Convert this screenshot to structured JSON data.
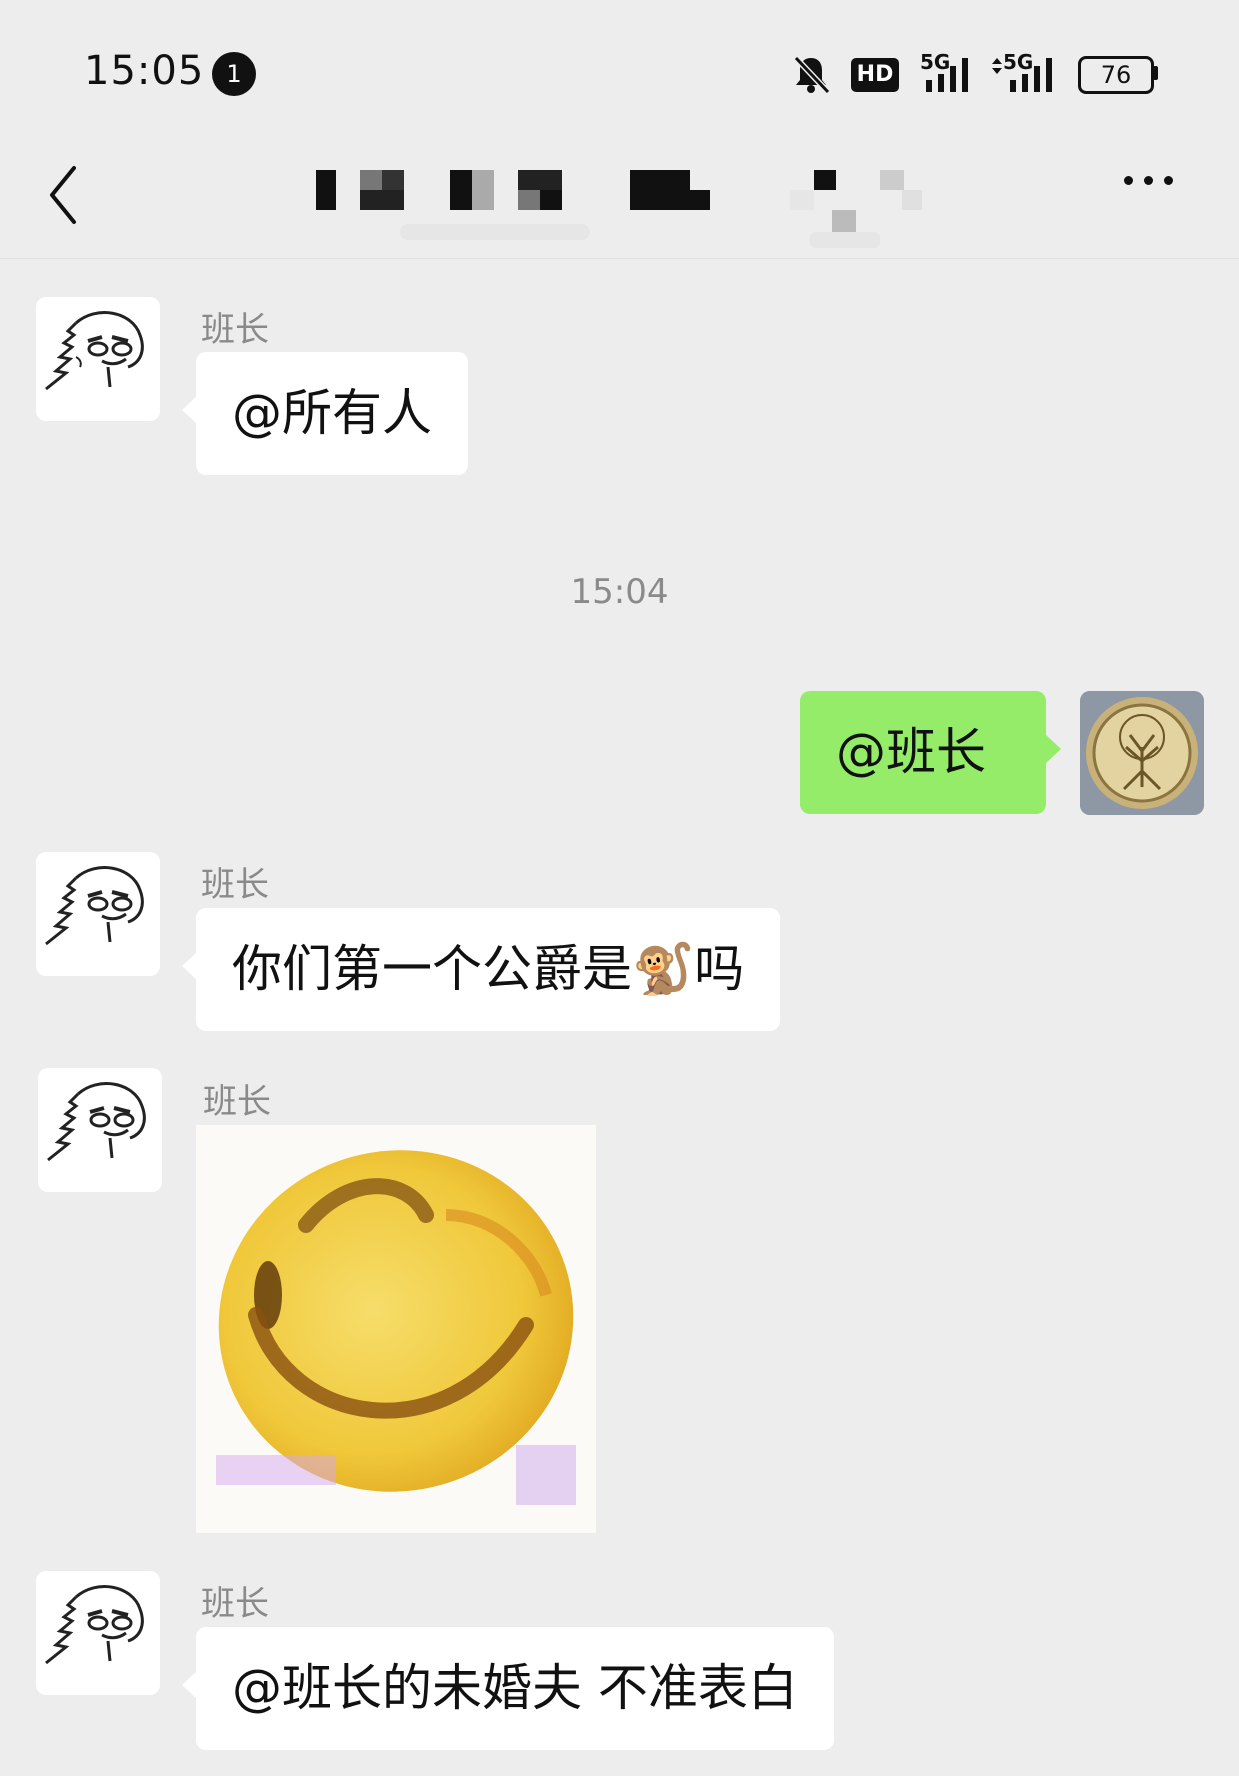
{
  "status_bar": {
    "time": "15:05",
    "notification_count": "1",
    "hd_label": "HD",
    "network_1": "5G",
    "network_2": "5G",
    "battery": "76"
  },
  "nav": {
    "title": ""
  },
  "timestamp": "15:04",
  "messages": [
    {
      "sender": "班长",
      "text": "@所有人"
    },
    {
      "text": "@班长"
    },
    {
      "sender": "班长",
      "text": "你们第一个公爵是🐒吗"
    },
    {
      "sender": "班长"
    },
    {
      "sender": "班长",
      "text": "@班长的未婚夫  不准表白"
    }
  ],
  "colors": {
    "background": "#ededed",
    "bubble_self": "#95ec69",
    "bubble_other": "#ffffff",
    "meta_text": "#8a8a8a"
  },
  "icons": [
    "back-icon",
    "more-icon",
    "mute-bell-icon",
    "signal-icon",
    "battery-icon",
    "notification-badge"
  ]
}
